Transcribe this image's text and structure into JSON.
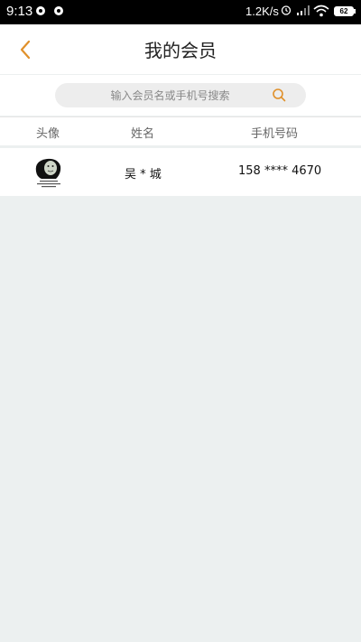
{
  "status_bar": {
    "time": "9:13",
    "network_speed": "1.2K/s",
    "battery": "62"
  },
  "header": {
    "title": "我的会员",
    "back_icon": "chevron-left-icon"
  },
  "search": {
    "placeholder": "输入会员名或手机号搜索",
    "value": ""
  },
  "table": {
    "columns": [
      "头像",
      "姓名",
      "手机号码"
    ],
    "rows": [
      {
        "avatar": "meme-avatar",
        "name": "吴 * 城",
        "phone": "158 **** 4670"
      }
    ]
  },
  "colors": {
    "accent": "#e0902a",
    "background": "#ecf0f0"
  }
}
